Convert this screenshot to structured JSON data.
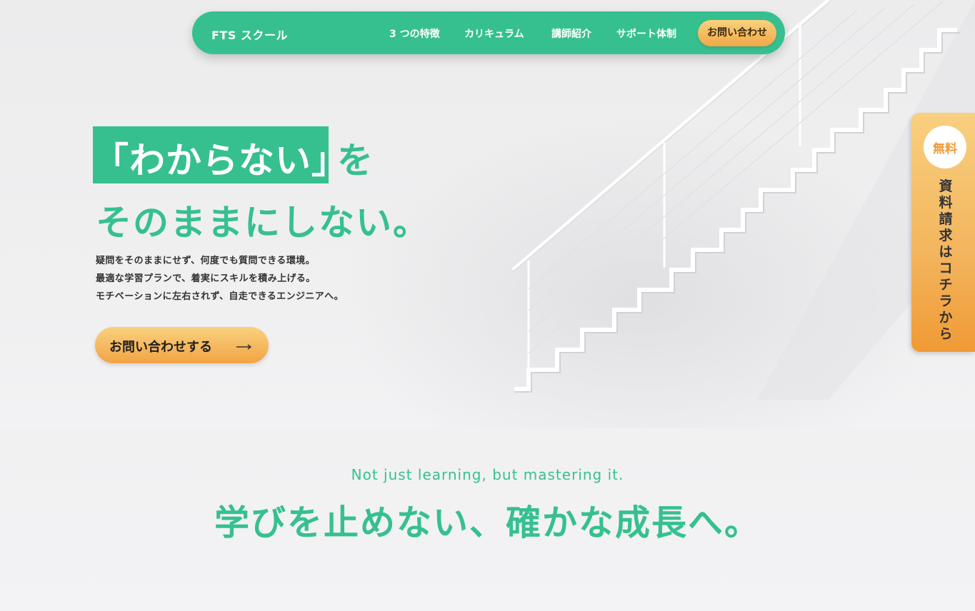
{
  "brand": {
    "name": "FTS スクール",
    "accent_color": "#36c08f",
    "cta_gradient": [
      "#f9d17d",
      "#f2a446"
    ]
  },
  "nav": {
    "items": [
      {
        "label": "3 つの特徴"
      },
      {
        "label": "カリキュラム"
      },
      {
        "label": "講師紹介"
      },
      {
        "label": "サポート体制"
      }
    ],
    "cta_label": "お問い合わせ"
  },
  "hero": {
    "headline_highlight": "「わからない」",
    "headline_suffix": "を",
    "headline_line2": "そのままにしない。",
    "description": [
      "疑問をそのままにせず、何度でも質問できる環境。",
      "最適な学習プランで、着実にスキルを積み上げる。",
      "モチベーションに左右されず、自走できるエンジニアへ。"
    ],
    "cta_label": "お問い合わせする",
    "cta_icon": "arrow-right-icon"
  },
  "side_tab": {
    "badge": "無料",
    "label": "資料請求はコチラから"
  },
  "section": {
    "tagline": "Not just learning, but mastering it.",
    "title": "学びを止めない、確かな成長へ。"
  }
}
